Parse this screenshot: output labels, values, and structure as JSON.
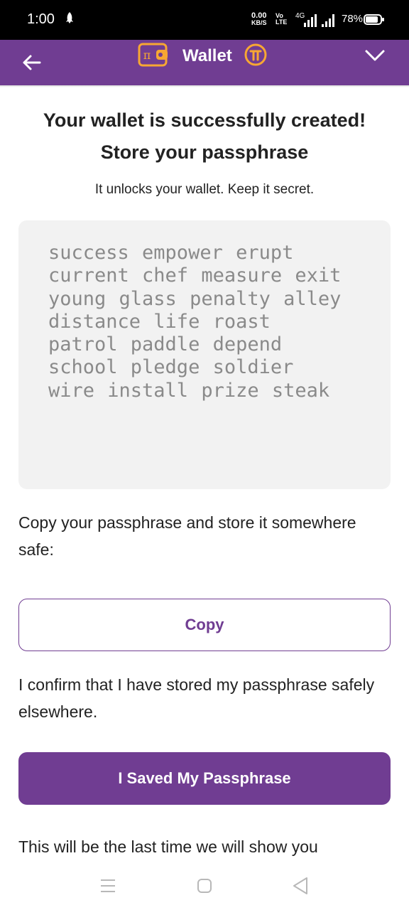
{
  "status_bar": {
    "time": "1:00",
    "net_speed_value": "0.00",
    "net_speed_unit": "KB/S",
    "volte_top": "Vo",
    "volte_bottom": "LTE",
    "network_type": "4G",
    "battery": "78%"
  },
  "app_bar": {
    "title": "Wallet",
    "accent_color": "#703d92",
    "logo_color": "#f7a733",
    "pi_symbol": "π"
  },
  "content": {
    "headline_line1": "Your wallet is successfully created!",
    "headline_line2": "Store your passphrase",
    "subtitle": "It unlocks your wallet. Keep it secret.",
    "passphrase": "success empower erupt\ncurrent chef measure exit\nyoung glass penalty alley\ndistance life roast\npatrol paddle depend\nschool pledge soldier\nwire install prize steak",
    "copy_instruction": "Copy your passphrase and store it somewhere safe:",
    "copy_button": "Copy",
    "confirm_text": "I confirm that I have stored my passphrase safely elsewhere.",
    "saved_button": "I Saved My Passphrase",
    "footer_text": "This will be the last time we will show you"
  },
  "icons": {
    "back": "arrow-left-icon",
    "chevron": "chevron-down-icon",
    "nav_menu": "recent-apps-icon",
    "nav_home": "home-icon",
    "nav_back": "triangle-back-icon"
  }
}
